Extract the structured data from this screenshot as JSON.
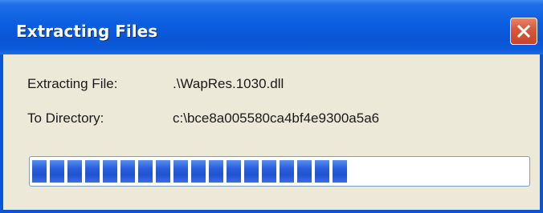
{
  "window": {
    "title": "Extracting Files"
  },
  "close_icon": "close-x-icon",
  "rows": {
    "file_label": "Extracting File:",
    "file_value": ".\\WapRes.1030.dll",
    "dir_label": "To Directory:",
    "dir_value": "c:\\bce8a005580ca4bf4e9300a5a6"
  },
  "progress": {
    "percent": 65
  },
  "colors": {
    "title_bar": "#0a56d6",
    "window_bg": "#ece9d8",
    "close_button": "#d85a3c",
    "progress_block": "#2b61de"
  }
}
